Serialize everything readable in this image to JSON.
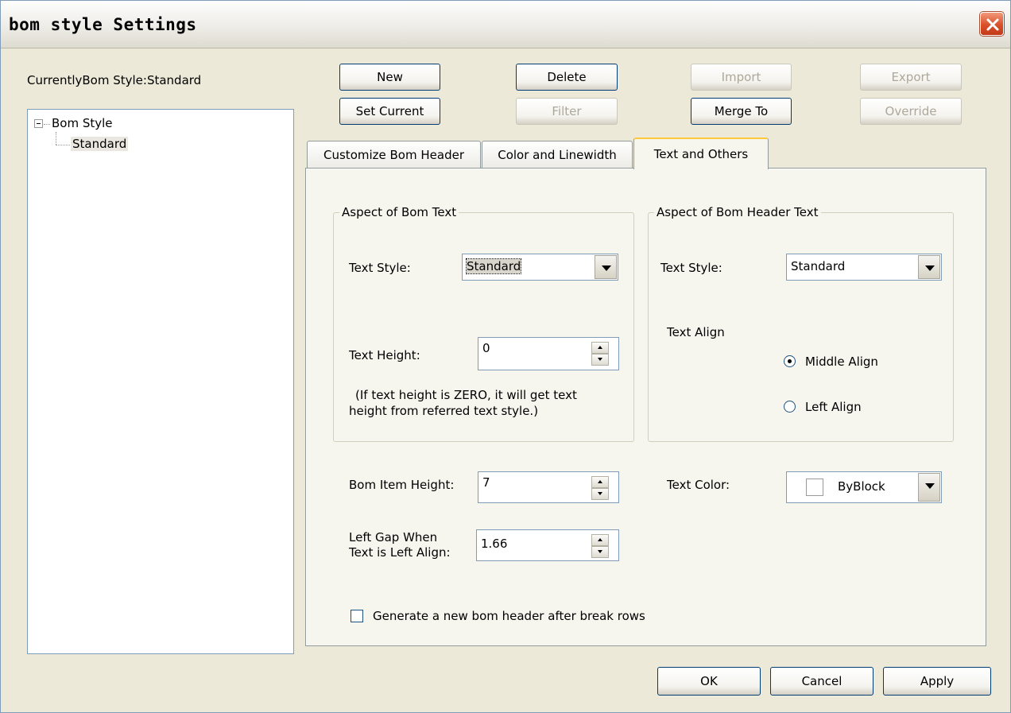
{
  "window": {
    "title": "bom style Settings"
  },
  "current_style": {
    "label": "CurrentlyBom Style:Standard"
  },
  "buttons": {
    "new": "New",
    "delete": "Delete",
    "import": "Import",
    "export": "Export",
    "set_current": "Set Current",
    "filter": "Filter",
    "merge_to": "Merge To",
    "override": "Override"
  },
  "tree": {
    "root": "Bom Style",
    "children": [
      "Standard"
    ]
  },
  "tabs": [
    "Customize Bom Header",
    "Color and Linewidth",
    "Text and Others"
  ],
  "active_tab": "Text and Others",
  "bom_text": {
    "group_title": "Aspect of Bom Text",
    "style_label": "Text Style:",
    "style_value": "Standard",
    "height_label": "Text Height:",
    "height_value": "0",
    "note_line1": "(If text height is ZERO, it will get text",
    "note_line2": "height from referred text style.)"
  },
  "header_text": {
    "group_title": "Aspect of Bom Header Text",
    "style_label": "Text Style:",
    "style_value": "Standard",
    "align_label": "Text Align",
    "align_middle": "Middle Align",
    "align_left": "Left Align",
    "selected_align": "Middle Align"
  },
  "item_height": {
    "label": "Bom Item Height:",
    "value": "7"
  },
  "left_gap": {
    "label_line1": "Left Gap When",
    "label_line2": "Text is Left Align:",
    "value": "1.66"
  },
  "text_color": {
    "label": "Text Color:",
    "value": "ByBlock"
  },
  "generate_header": {
    "label": "Generate a new bom header after break rows",
    "checked": false
  },
  "footer": {
    "ok": "OK",
    "cancel": "Cancel",
    "apply": "Apply"
  }
}
